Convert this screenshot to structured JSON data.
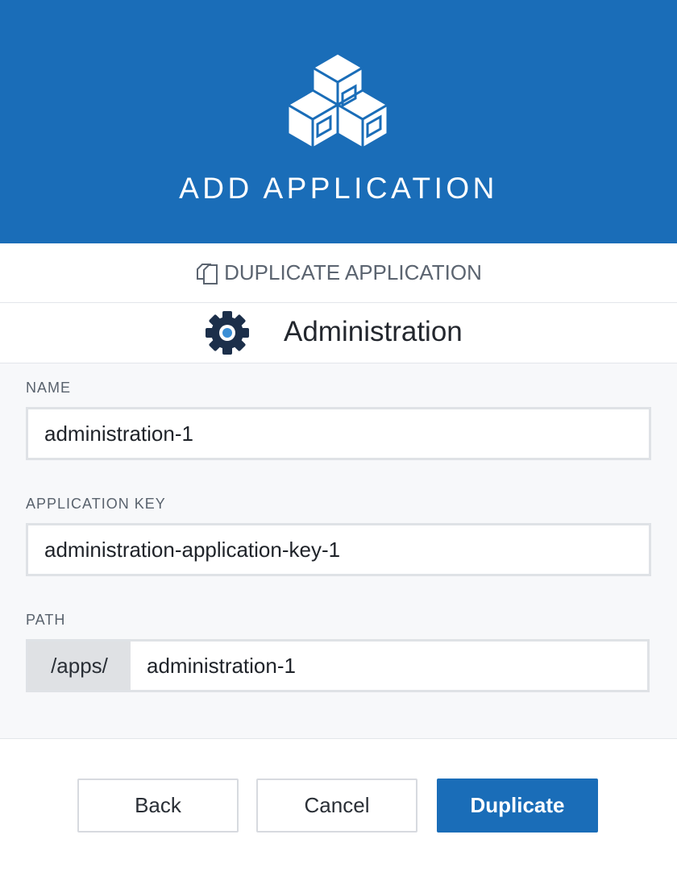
{
  "header": {
    "title": "ADD APPLICATION",
    "logo_icon": "stacked-cubes-icon",
    "background_color": "#1a6db8"
  },
  "subheader": {
    "icon": "copy-icon",
    "label": "DUPLICATE APPLICATION"
  },
  "application": {
    "icon": "gear-icon",
    "name": "Administration"
  },
  "form": {
    "name": {
      "label": "NAME",
      "value": "administration-1"
    },
    "key": {
      "label": "APPLICATION KEY",
      "value": "administration-application-key-1"
    },
    "path": {
      "label": "PATH",
      "prefix": "/apps/",
      "value": "administration-1"
    }
  },
  "buttons": {
    "back": "Back",
    "cancel": "Cancel",
    "duplicate": "Duplicate",
    "primary_color": "#1a6db8"
  }
}
